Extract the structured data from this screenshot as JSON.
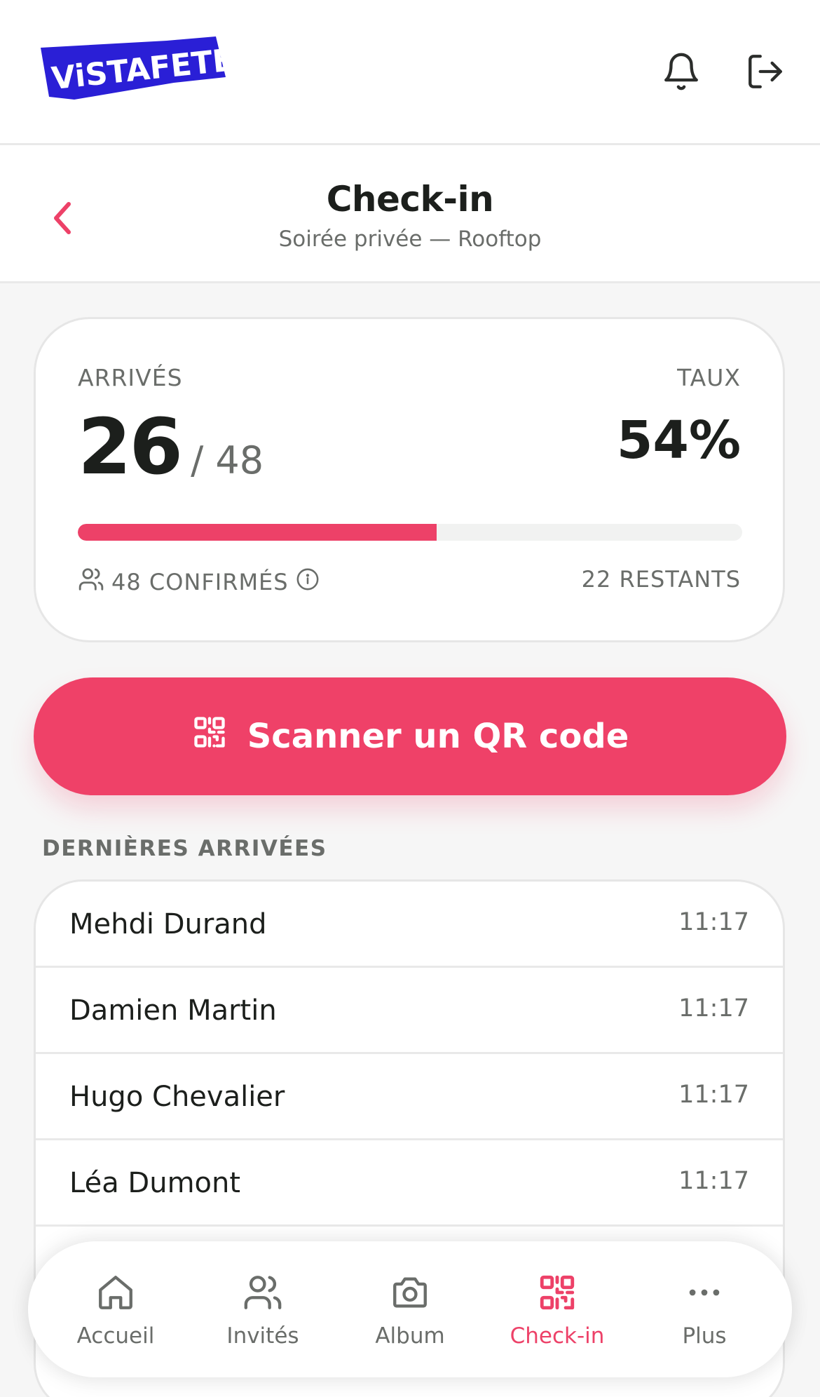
{
  "brand": {
    "logo_text": "ViSTAFETE",
    "logo_color": "#2a1fd6"
  },
  "topbar": {
    "icons": [
      "bell-icon",
      "logout-icon"
    ]
  },
  "header": {
    "title": "Check-in",
    "subtitle": "Soirée privée — Rooftop",
    "back_icon": "chevron-left-icon"
  },
  "stats": {
    "arrived_label": "ARRIVÉS",
    "arrived": "26",
    "total": "/ 48",
    "rate_label": "TAUX",
    "rate": "54%",
    "progress_fraction": 0.54,
    "confirmed": "48 CONFIRMÉS",
    "remaining": "22 RESTANTS"
  },
  "scan_button": {
    "label": "Scanner un QR code"
  },
  "recent": {
    "title": "DERNIÈRES ARRIVÉES",
    "rows": [
      {
        "name": "Mehdi Durand",
        "time": "11:17"
      },
      {
        "name": "Damien Martin",
        "time": "11:17"
      },
      {
        "name": "Hugo Chevalier",
        "time": "11:17"
      },
      {
        "name": "Léa Dumont",
        "time": "11:17"
      }
    ]
  },
  "bottom_nav": {
    "items": [
      {
        "label": "Accueil",
        "icon": "home-icon"
      },
      {
        "label": "Invités",
        "icon": "users-icon"
      },
      {
        "label": "Album",
        "icon": "camera-icon"
      },
      {
        "label": "Check-in",
        "icon": "qr-code-icon",
        "active": true
      },
      {
        "label": "Plus",
        "icon": "more-icon"
      }
    ]
  },
  "colors": {
    "accent": "#ed4168",
    "text": "#1c1f1c",
    "muted": "#6a6d6a"
  }
}
